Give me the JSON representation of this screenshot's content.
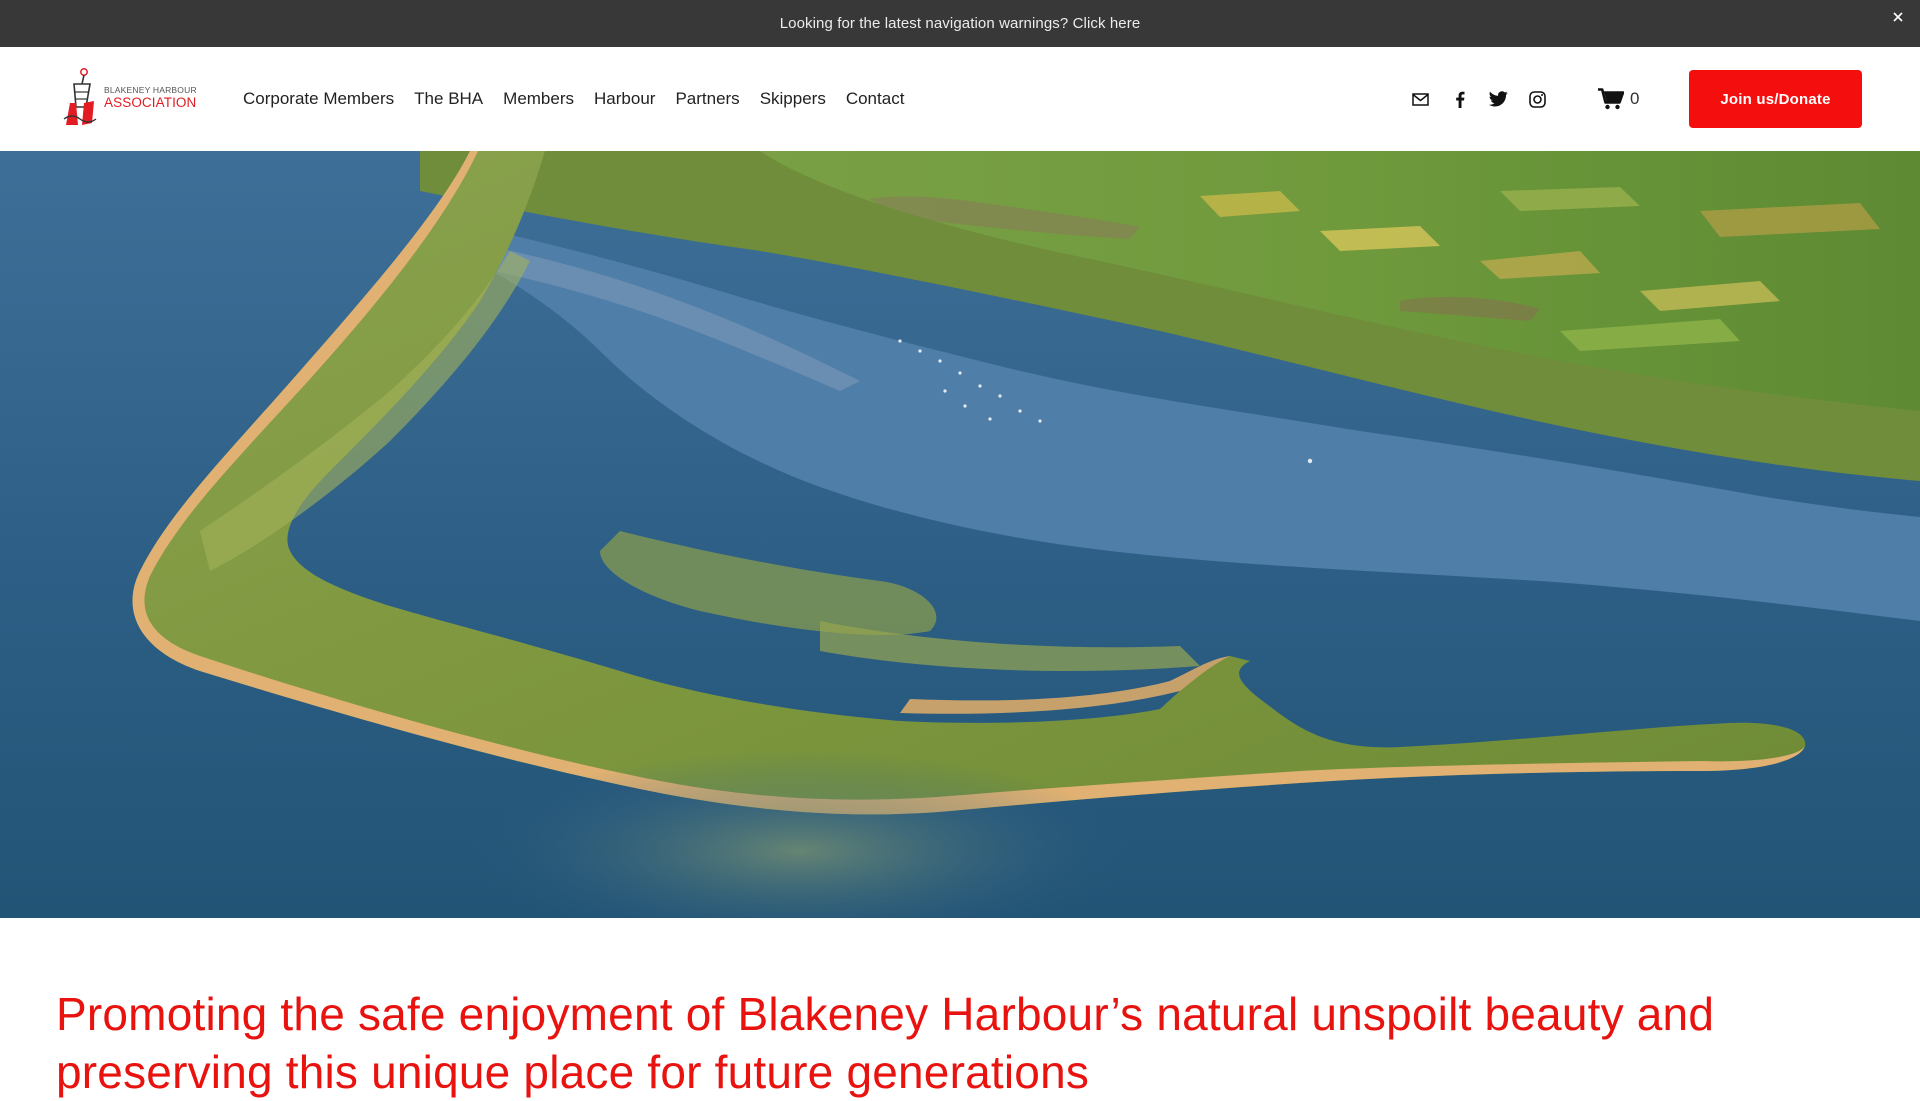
{
  "announcement": {
    "text": "Looking for the latest navigation warnings? Click here",
    "close_label": "×"
  },
  "header": {
    "logo": {
      "line1": "BLAKENEY HARBOUR",
      "line2": "ASSOCIATION"
    },
    "nav": [
      {
        "label": "Corporate Members"
      },
      {
        "label": "The BHA"
      },
      {
        "label": "Members"
      },
      {
        "label": "Harbour"
      },
      {
        "label": "Partners"
      },
      {
        "label": "Skippers"
      },
      {
        "label": "Contact"
      }
    ],
    "social_icons": [
      "email-icon",
      "facebook-icon",
      "twitter-icon",
      "instagram-icon"
    ],
    "cart": {
      "icon": "cart-icon",
      "count": "0"
    },
    "cta_label": "Join us/Donate"
  },
  "hero": {
    "image": "aerial-photo-blakeney-point"
  },
  "intro": {
    "heading": "Promoting the safe enjoyment of Blakeney Harbour’s natural unspoilt beauty and preserving this unique place for future generations"
  },
  "colors": {
    "accent": "#f40e0e",
    "announcement_bg": "#383838",
    "heading": "#e8120f"
  }
}
